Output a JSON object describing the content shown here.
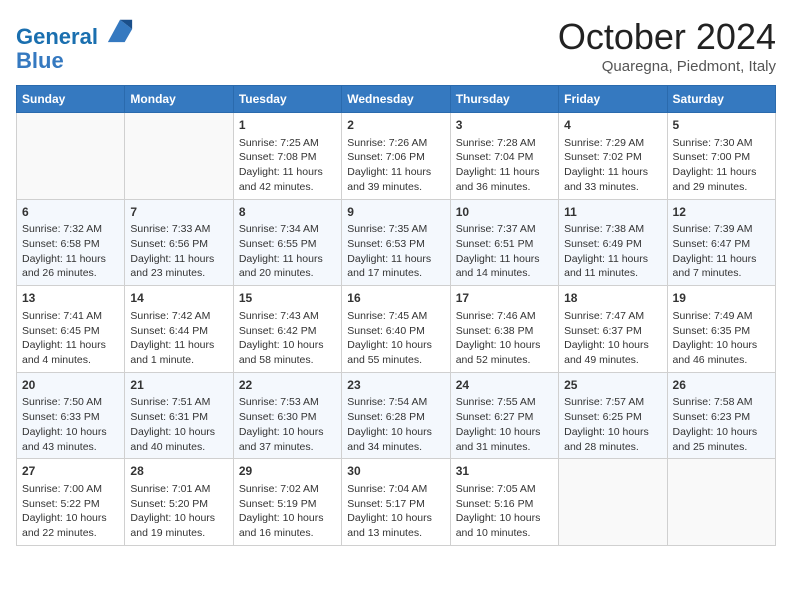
{
  "header": {
    "logo_line1": "General",
    "logo_line2": "Blue",
    "title": "October 2024",
    "location": "Quaregna, Piedmont, Italy"
  },
  "days_of_week": [
    "Sunday",
    "Monday",
    "Tuesday",
    "Wednesday",
    "Thursday",
    "Friday",
    "Saturday"
  ],
  "weeks": [
    [
      {
        "day": "",
        "empty": true
      },
      {
        "day": "",
        "empty": true
      },
      {
        "day": "1",
        "sunrise": "Sunrise: 7:25 AM",
        "sunset": "Sunset: 7:08 PM",
        "daylight": "Daylight: 11 hours and 42 minutes."
      },
      {
        "day": "2",
        "sunrise": "Sunrise: 7:26 AM",
        "sunset": "Sunset: 7:06 PM",
        "daylight": "Daylight: 11 hours and 39 minutes."
      },
      {
        "day": "3",
        "sunrise": "Sunrise: 7:28 AM",
        "sunset": "Sunset: 7:04 PM",
        "daylight": "Daylight: 11 hours and 36 minutes."
      },
      {
        "day": "4",
        "sunrise": "Sunrise: 7:29 AM",
        "sunset": "Sunset: 7:02 PM",
        "daylight": "Daylight: 11 hours and 33 minutes."
      },
      {
        "day": "5",
        "sunrise": "Sunrise: 7:30 AM",
        "sunset": "Sunset: 7:00 PM",
        "daylight": "Daylight: 11 hours and 29 minutes."
      }
    ],
    [
      {
        "day": "6",
        "sunrise": "Sunrise: 7:32 AM",
        "sunset": "Sunset: 6:58 PM",
        "daylight": "Daylight: 11 hours and 26 minutes."
      },
      {
        "day": "7",
        "sunrise": "Sunrise: 7:33 AM",
        "sunset": "Sunset: 6:56 PM",
        "daylight": "Daylight: 11 hours and 23 minutes."
      },
      {
        "day": "8",
        "sunrise": "Sunrise: 7:34 AM",
        "sunset": "Sunset: 6:55 PM",
        "daylight": "Daylight: 11 hours and 20 minutes."
      },
      {
        "day": "9",
        "sunrise": "Sunrise: 7:35 AM",
        "sunset": "Sunset: 6:53 PM",
        "daylight": "Daylight: 11 hours and 17 minutes."
      },
      {
        "day": "10",
        "sunrise": "Sunrise: 7:37 AM",
        "sunset": "Sunset: 6:51 PM",
        "daylight": "Daylight: 11 hours and 14 minutes."
      },
      {
        "day": "11",
        "sunrise": "Sunrise: 7:38 AM",
        "sunset": "Sunset: 6:49 PM",
        "daylight": "Daylight: 11 hours and 11 minutes."
      },
      {
        "day": "12",
        "sunrise": "Sunrise: 7:39 AM",
        "sunset": "Sunset: 6:47 PM",
        "daylight": "Daylight: 11 hours and 7 minutes."
      }
    ],
    [
      {
        "day": "13",
        "sunrise": "Sunrise: 7:41 AM",
        "sunset": "Sunset: 6:45 PM",
        "daylight": "Daylight: 11 hours and 4 minutes."
      },
      {
        "day": "14",
        "sunrise": "Sunrise: 7:42 AM",
        "sunset": "Sunset: 6:44 PM",
        "daylight": "Daylight: 11 hours and 1 minute."
      },
      {
        "day": "15",
        "sunrise": "Sunrise: 7:43 AM",
        "sunset": "Sunset: 6:42 PM",
        "daylight": "Daylight: 10 hours and 58 minutes."
      },
      {
        "day": "16",
        "sunrise": "Sunrise: 7:45 AM",
        "sunset": "Sunset: 6:40 PM",
        "daylight": "Daylight: 10 hours and 55 minutes."
      },
      {
        "day": "17",
        "sunrise": "Sunrise: 7:46 AM",
        "sunset": "Sunset: 6:38 PM",
        "daylight": "Daylight: 10 hours and 52 minutes."
      },
      {
        "day": "18",
        "sunrise": "Sunrise: 7:47 AM",
        "sunset": "Sunset: 6:37 PM",
        "daylight": "Daylight: 10 hours and 49 minutes."
      },
      {
        "day": "19",
        "sunrise": "Sunrise: 7:49 AM",
        "sunset": "Sunset: 6:35 PM",
        "daylight": "Daylight: 10 hours and 46 minutes."
      }
    ],
    [
      {
        "day": "20",
        "sunrise": "Sunrise: 7:50 AM",
        "sunset": "Sunset: 6:33 PM",
        "daylight": "Daylight: 10 hours and 43 minutes."
      },
      {
        "day": "21",
        "sunrise": "Sunrise: 7:51 AM",
        "sunset": "Sunset: 6:31 PM",
        "daylight": "Daylight: 10 hours and 40 minutes."
      },
      {
        "day": "22",
        "sunrise": "Sunrise: 7:53 AM",
        "sunset": "Sunset: 6:30 PM",
        "daylight": "Daylight: 10 hours and 37 minutes."
      },
      {
        "day": "23",
        "sunrise": "Sunrise: 7:54 AM",
        "sunset": "Sunset: 6:28 PM",
        "daylight": "Daylight: 10 hours and 34 minutes."
      },
      {
        "day": "24",
        "sunrise": "Sunrise: 7:55 AM",
        "sunset": "Sunset: 6:27 PM",
        "daylight": "Daylight: 10 hours and 31 minutes."
      },
      {
        "day": "25",
        "sunrise": "Sunrise: 7:57 AM",
        "sunset": "Sunset: 6:25 PM",
        "daylight": "Daylight: 10 hours and 28 minutes."
      },
      {
        "day": "26",
        "sunrise": "Sunrise: 7:58 AM",
        "sunset": "Sunset: 6:23 PM",
        "daylight": "Daylight: 10 hours and 25 minutes."
      }
    ],
    [
      {
        "day": "27",
        "sunrise": "Sunrise: 7:00 AM",
        "sunset": "Sunset: 5:22 PM",
        "daylight": "Daylight: 10 hours and 22 minutes."
      },
      {
        "day": "28",
        "sunrise": "Sunrise: 7:01 AM",
        "sunset": "Sunset: 5:20 PM",
        "daylight": "Daylight: 10 hours and 19 minutes."
      },
      {
        "day": "29",
        "sunrise": "Sunrise: 7:02 AM",
        "sunset": "Sunset: 5:19 PM",
        "daylight": "Daylight: 10 hours and 16 minutes."
      },
      {
        "day": "30",
        "sunrise": "Sunrise: 7:04 AM",
        "sunset": "Sunset: 5:17 PM",
        "daylight": "Daylight: 10 hours and 13 minutes."
      },
      {
        "day": "31",
        "sunrise": "Sunrise: 7:05 AM",
        "sunset": "Sunset: 5:16 PM",
        "daylight": "Daylight: 10 hours and 10 minutes."
      },
      {
        "day": "",
        "empty": true
      },
      {
        "day": "",
        "empty": true
      }
    ]
  ]
}
